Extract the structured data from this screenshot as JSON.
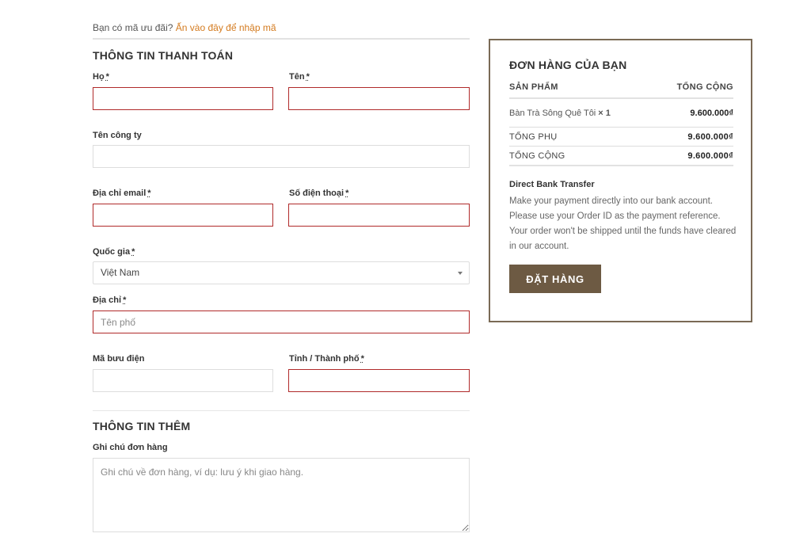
{
  "coupon": {
    "prompt": "Bạn có mã ưu đãi?",
    "link": "Ấn vào đây để nhập mã"
  },
  "billing": {
    "title": "THÔNG TIN THANH TOÁN",
    "required_mark": "*",
    "last_name_label": "Họ",
    "first_name_label": "Tên",
    "company_label": "Tên công ty",
    "email_label": "Địa chỉ email",
    "phone_label": "Số điện thoại",
    "country_label": "Quốc gia",
    "country_value": "Việt Nam",
    "address_label": "Địa chỉ",
    "address_placeholder": "Tên phố",
    "postcode_label": "Mã bưu điện",
    "city_label": "Tỉnh / Thành phố"
  },
  "additional": {
    "title": "THÔNG TIN THÊM",
    "notes_label": "Ghi chú đơn hàng",
    "notes_placeholder": "Ghi chú về đơn hàng, ví dụ: lưu ý khi giao hàng."
  },
  "order": {
    "title": "ĐƠN HÀNG CỦA BẠN",
    "col_product": "SẢN PHẨM",
    "col_total": "TỔNG CỘNG",
    "item_name": "Bàn Trà Sông Quê Tôi",
    "item_qty": "× 1",
    "item_total": "9.600.000₫",
    "subtotal_label": "TỔNG PHỤ",
    "subtotal_value": "9.600.000₫",
    "total_label": "TỔNG CỘNG",
    "total_value": "9.600.000₫",
    "payment_title": "Direct Bank Transfer",
    "payment_desc": "Make your payment directly into our bank account. Please use your Order ID as the payment reference. Your order won't be shipped until the funds have cleared in our account.",
    "place_order_label": "ĐẶT HÀNG"
  },
  "colors": {
    "accent": "#d47b1f",
    "error_border": "#b02a2a",
    "button": "#6d5a43",
    "order_border": "#7a6a55"
  }
}
